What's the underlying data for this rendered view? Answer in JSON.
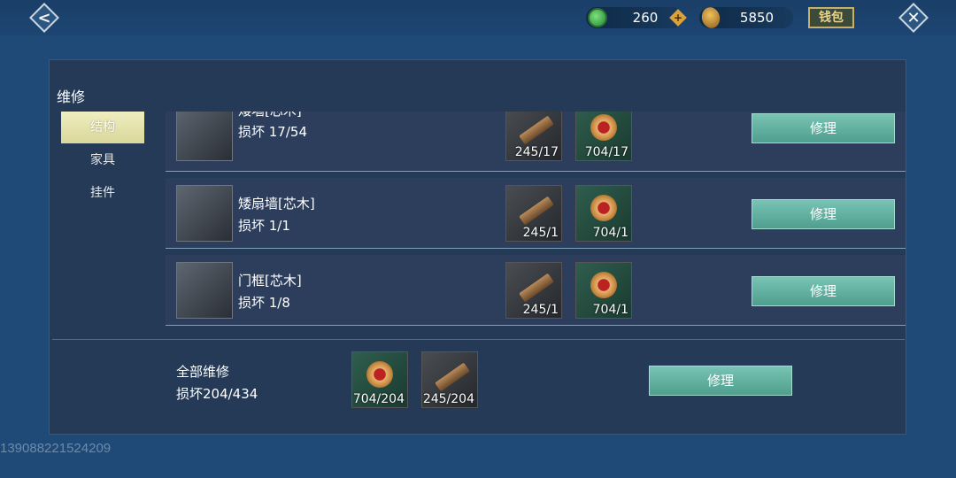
{
  "topbar": {
    "jade_value": "260",
    "gold_value": "5850",
    "wallet_label": "钱包"
  },
  "panel": {
    "title": "维修",
    "tabs": [
      {
        "label": "结构",
        "active": true
      },
      {
        "label": "家具",
        "active": false
      },
      {
        "label": "挂件",
        "active": false
      }
    ],
    "items": [
      {
        "name": "矮墙[芯木]",
        "damage": "损坏 17/54",
        "mat_wood": "245/17",
        "mat_log": "704/17",
        "button": "修理"
      },
      {
        "name": "矮扇墙[芯木]",
        "damage": "损坏 1/1",
        "mat_wood": "245/1",
        "mat_log": "704/1",
        "button": "修理"
      },
      {
        "name": "门框[芯木]",
        "damage": "损坏 1/8",
        "mat_wood": "245/1",
        "mat_log": "704/1",
        "button": "修理"
      }
    ],
    "repair_all": {
      "title": "全部维修",
      "damage": "损坏204/434",
      "mat_log": "704/204",
      "mat_wood": "245/204",
      "button": "修理"
    }
  },
  "watermark": "13908822152420​9"
}
